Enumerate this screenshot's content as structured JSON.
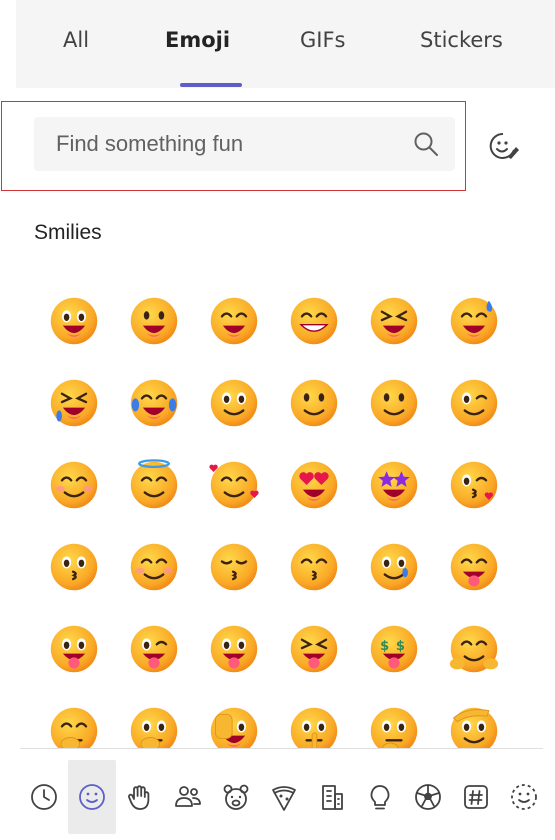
{
  "tabs": [
    {
      "label": "All",
      "active": false
    },
    {
      "label": "Emoji",
      "active": true
    },
    {
      "label": "GIFs",
      "active": false
    },
    {
      "label": "Stickers",
      "active": false
    }
  ],
  "colors": {
    "accent": "#5b5fc7",
    "highlight_border": "#d13438"
  },
  "search": {
    "placeholder": "Find something fun",
    "value": ""
  },
  "section_title": "Smilies",
  "emojis": [
    "grinning-face-with-big-eyes",
    "grinning-face",
    "grinning-face-with-smiling-eyes",
    "beaming-face",
    "grinning-squinting-face",
    "grinning-face-with-sweat",
    "rolling-on-the-floor-laughing",
    "face-with-tears-of-joy",
    "slightly-smiling-face",
    "upside-down-face",
    "melting-face",
    "winking-face",
    "smiling-face-with-smiling-eyes",
    "smiling-face-with-halo",
    "smiling-face-with-hearts",
    "smiling-face-with-heart-eyes",
    "star-struck",
    "face-blowing-a-kiss",
    "kissing-face",
    "smiling-face",
    "kissing-face-with-closed-eyes",
    "kissing-face-with-smiling-eyes",
    "smiling-face-with-tear",
    "face-savoring-food",
    "face-with-tongue",
    "winking-face-with-tongue",
    "zany-face",
    "squinting-face-with-tongue",
    "money-mouth-face",
    "smiling-face-with-open-hands",
    "face-with-hand-over-mouth",
    "face-with-open-eyes-and-hand-over-mouth",
    "face-with-peeking-eye",
    "shushing-face",
    "thinking-face",
    "saluting-face"
  ],
  "categories": [
    {
      "icon": "clock-icon",
      "name": "recent",
      "active": false
    },
    {
      "icon": "smiley-icon",
      "name": "smilies",
      "active": true
    },
    {
      "icon": "hand-icon",
      "name": "hand-gestures",
      "active": false
    },
    {
      "icon": "people-icon",
      "name": "people",
      "active": false
    },
    {
      "icon": "animal-icon",
      "name": "animals",
      "active": false
    },
    {
      "icon": "pizza-icon",
      "name": "food",
      "active": false
    },
    {
      "icon": "building-icon",
      "name": "travel-places",
      "active": false
    },
    {
      "icon": "lightbulb-icon",
      "name": "objects",
      "active": false
    },
    {
      "icon": "soccer-ball-icon",
      "name": "activities",
      "active": false
    },
    {
      "icon": "hashtag-icon",
      "name": "symbols",
      "active": false
    },
    {
      "icon": "dashed-smiley-icon",
      "name": "custom",
      "active": false
    }
  ]
}
